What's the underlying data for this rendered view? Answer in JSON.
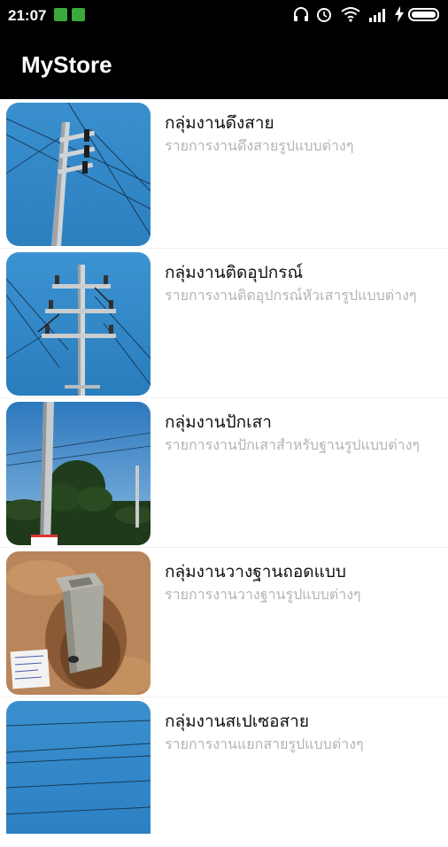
{
  "status_bar": {
    "time": "21:07",
    "icons": [
      "headphones-icon",
      "alarm-icon",
      "wifi-icon",
      "signal-icon",
      "charging-icon",
      "battery-icon"
    ]
  },
  "app_bar": {
    "title": "MyStore"
  },
  "items": [
    {
      "title": "กลุ่มงานดึงสาย",
      "subtitle": "รายการงานดึงสายรูปแบบต่างๆ",
      "image": "power-pole-crossarm-photo"
    },
    {
      "title": "กลุ่มงานติดอุปกรณ์",
      "subtitle": "รายการงานติดอุปกรณ์หัวเสารูปแบบต่างๆ",
      "image": "power-pole-insulators-photo"
    },
    {
      "title": "กลุ่มงานปักเสา",
      "subtitle": "รายการงานปักเสาสำหรับฐานรูปแบบต่างๆ",
      "image": "pole-and-tree-photo"
    },
    {
      "title": "กลุ่มงานวางฐานถอดแบบ",
      "subtitle": "รายการงานวางฐานรูปแบบต่างๆ",
      "image": "concrete-base-in-pit-photo"
    },
    {
      "title": "กลุ่มงานสเปเซอสาย",
      "subtitle": "รายการงานแยกสายรูปแบบต่างๆ",
      "image": "power-lines-sky-photo"
    }
  ],
  "colors": {
    "app_bar": "#000000",
    "title": "#111111",
    "subtitle": "#b4b4b4",
    "sky": "#2f86c6"
  }
}
